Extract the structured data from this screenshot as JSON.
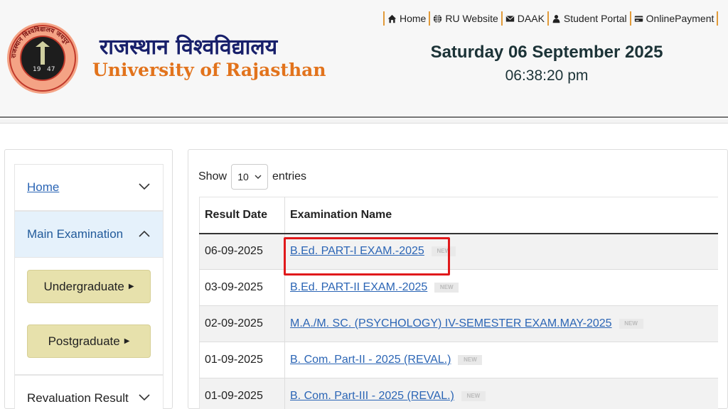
{
  "header": {
    "seal_text": "राजस्थान विश्वविद्यालय जयपुर",
    "seal_year_left": "19",
    "seal_year_right": "47",
    "brand_hindi": "राजस्थान विश्वविद्यालय",
    "brand_english": "University of Rajasthan",
    "date": "Saturday 06 September 2025",
    "time": "06:38:20 pm"
  },
  "topnav": [
    {
      "label": "Home",
      "icon": "home-icon"
    },
    {
      "label": "RU Website",
      "icon": "globe-icon"
    },
    {
      "label": "DAAK",
      "icon": "envelope-icon"
    },
    {
      "label": "Student Portal",
      "icon": "student-icon"
    },
    {
      "label": "OnlinePayment",
      "icon": "card-icon"
    }
  ],
  "sidebar": {
    "home": "Home",
    "main_examination": "Main Examination",
    "undergraduate": "Undergraduate",
    "postgraduate": "Postgraduate",
    "revaluation": "Revaluation Result"
  },
  "table": {
    "show_label": "Show",
    "entries_value": "10",
    "entries_label": "entries",
    "headers": [
      "Result Date",
      "Examination Name"
    ],
    "new_badge": "NEW",
    "rows": [
      {
        "date": "06-09-2025",
        "name": "B.Ed. PART-I EXAM.-2025"
      },
      {
        "date": "03-09-2025",
        "name": "B.Ed. PART-II EXAM.-2025"
      },
      {
        "date": "02-09-2025",
        "name": "M.A./M. SC. (PSYCHOLOGY) IV-SEMESTER EXAM.MAY-2025"
      },
      {
        "date": "01-09-2025",
        "name": "B. Com. Part-II - 2025 (REVAL.)"
      },
      {
        "date": "01-09-2025",
        "name": "B. Com. Part-III - 2025 (REVAL.)"
      }
    ]
  },
  "colors": {
    "accent_link": "#2b65b5",
    "brand_navy": "#18206b",
    "brand_orange": "#e2731c",
    "button_khaki": "#e7e1ac",
    "highlight_red": "#e0191b"
  }
}
